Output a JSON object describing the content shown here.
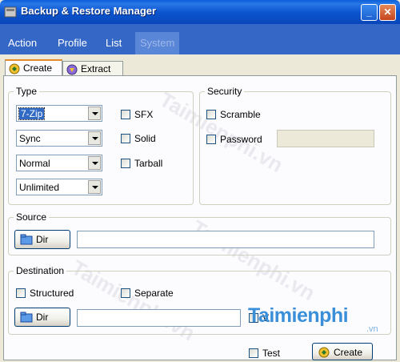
{
  "window": {
    "title": "Backup & Restore Manager"
  },
  "menu": {
    "items": [
      "Action",
      "Profile",
      "List",
      "System"
    ]
  },
  "tabs": [
    {
      "label": "Create"
    },
    {
      "label": "Extract"
    }
  ],
  "type_group": {
    "title": "Type",
    "format": "7-Zip",
    "mode": "Sync",
    "compression": "Normal",
    "split": "Unlimited",
    "sfx_label": "SFX",
    "solid_label": "Solid",
    "tarball_label": "Tarball"
  },
  "security_group": {
    "title": "Security",
    "scramble_label": "Scramble",
    "password_label": "Password",
    "password_value": ""
  },
  "source_group": {
    "title": "Source",
    "dir_button": "Dir",
    "path_value": ""
  },
  "destination_group": {
    "title": "Destination",
    "structured_label": "Structured",
    "separate_label": "Separate",
    "dir_button": "Dir",
    "path_value": "",
    "v_label": "V"
  },
  "footer": {
    "test_label": "Test",
    "create_button": "Create"
  },
  "watermark": {
    "text": "Taimienphi.vn",
    "logo": "Taimienphi",
    "logo_suffix": ".vn"
  },
  "colors": {
    "titlebar": "#0a5fd8",
    "menubar": "#3567c6",
    "tab_accent": "#e68b2c",
    "logo": "#3a8fd8"
  }
}
